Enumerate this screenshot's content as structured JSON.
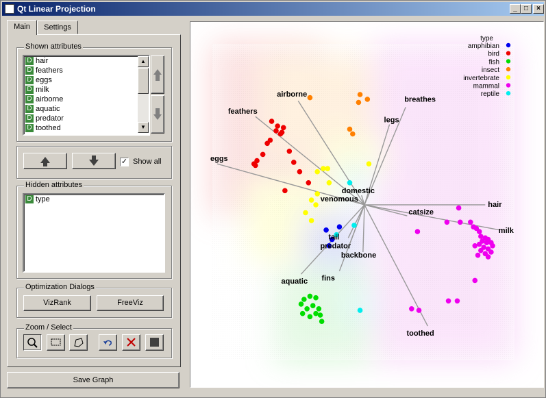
{
  "window": {
    "title": "Qt Linear Projection",
    "controls": [
      "_",
      "□",
      "×"
    ]
  },
  "tabs": [
    {
      "label": "Main",
      "active": true
    },
    {
      "label": "Settings",
      "active": false
    }
  ],
  "shown_attributes": {
    "label": "Shown attributes",
    "items": [
      "hair",
      "feathers",
      "eggs",
      "milk",
      "airborne",
      "aquatic",
      "predator",
      "toothed"
    ]
  },
  "show_all": {
    "label": "Show all",
    "checked": true
  },
  "hidden_attributes": {
    "label": "Hidden attributes",
    "items": [
      "type"
    ]
  },
  "optimization": {
    "label": "Optimization Dialogs",
    "vizrank": "VizRank",
    "freeviz": "FreeViz"
  },
  "zoom_select": {
    "label": "Zoom / Select"
  },
  "save_graph": "Save Graph",
  "attribute_badge": "D",
  "colors": {
    "amphibian": "#0000ee",
    "bird": "#ee0000",
    "fish": "#00dd00",
    "insect": "#ff8000",
    "invertebrate": "#ffff00",
    "mammal": "#ee00ee",
    "reptile": "#00eeee"
  },
  "chart_data": {
    "type": "scatter",
    "legend": {
      "title": "type",
      "placement": "top-right",
      "entries": [
        "amphibian",
        "bird",
        "fish",
        "insect",
        "invertebrate",
        "mammal",
        "reptile"
      ]
    },
    "anchors": [
      {
        "name": "airborne",
        "x": -0.45,
        "y": 0.66
      },
      {
        "name": "breathes",
        "x": 0.28,
        "y": 0.62
      },
      {
        "name": "legs",
        "x": 0.17,
        "y": 0.51
      },
      {
        "name": "feathers",
        "x": -0.74,
        "y": 0.56
      },
      {
        "name": "eggs",
        "x": -1.0,
        "y": 0.26
      },
      {
        "name": "domestic",
        "x": -0.02,
        "y": 0.06
      },
      {
        "name": "venomous",
        "x": -0.08,
        "y": 0.03
      },
      {
        "name": "hair",
        "x": 0.82,
        "y": 0.0
      },
      {
        "name": "catsize",
        "x": 0.29,
        "y": -0.07
      },
      {
        "name": "milk",
        "x": 0.92,
        "y": -0.16
      },
      {
        "name": "tail",
        "x": -0.11,
        "y": -0.21
      },
      {
        "name": "predator",
        "x": -0.1,
        "y": -0.25
      },
      {
        "name": "backbone",
        "x": -0.01,
        "y": -0.3
      },
      {
        "name": "aquatic",
        "x": -0.43,
        "y": -0.44
      },
      {
        "name": "fins",
        "x": -0.17,
        "y": -0.42
      },
      {
        "name": "toothed",
        "x": 0.43,
        "y": -0.77
      }
    ],
    "points": [
      {
        "c": "amphibian",
        "x": -0.26,
        "y": -0.16
      },
      {
        "c": "amphibian",
        "x": -0.17,
        "y": -0.14
      },
      {
        "c": "amphibian",
        "x": -0.22,
        "y": -0.22
      },
      {
        "c": "amphibian",
        "x": -0.24,
        "y": -0.26
      },
      {
        "c": "bird",
        "x": -0.63,
        "y": 0.53
      },
      {
        "c": "bird",
        "x": -0.59,
        "y": 0.5
      },
      {
        "c": "bird",
        "x": -0.6,
        "y": 0.47
      },
      {
        "c": "bird",
        "x": -0.56,
        "y": 0.46
      },
      {
        "c": "bird",
        "x": -0.55,
        "y": 0.49
      },
      {
        "c": "bird",
        "x": -0.57,
        "y": 0.45
      },
      {
        "c": "bird",
        "x": -0.64,
        "y": 0.41
      },
      {
        "c": "bird",
        "x": -0.66,
        "y": 0.39
      },
      {
        "c": "bird",
        "x": -0.69,
        "y": 0.32
      },
      {
        "c": "bird",
        "x": -0.73,
        "y": 0.28
      },
      {
        "c": "bird",
        "x": -0.75,
        "y": 0.26
      },
      {
        "c": "bird",
        "x": -0.74,
        "y": 0.25
      },
      {
        "c": "bird",
        "x": -0.51,
        "y": 0.34
      },
      {
        "c": "bird",
        "x": -0.48,
        "y": 0.27
      },
      {
        "c": "bird",
        "x": -0.44,
        "y": 0.21
      },
      {
        "c": "bird",
        "x": -0.38,
        "y": 0.14
      },
      {
        "c": "bird",
        "x": -0.54,
        "y": 0.09
      },
      {
        "c": "fish",
        "x": -0.41,
        "y": -0.6
      },
      {
        "c": "fish",
        "x": -0.37,
        "y": -0.58
      },
      {
        "c": "fish",
        "x": -0.33,
        "y": -0.59
      },
      {
        "c": "fish",
        "x": -0.35,
        "y": -0.64
      },
      {
        "c": "fish",
        "x": -0.31,
        "y": -0.66
      },
      {
        "c": "fish",
        "x": -0.43,
        "y": -0.63
      },
      {
        "c": "fish",
        "x": -0.39,
        "y": -0.66
      },
      {
        "c": "fish",
        "x": -0.42,
        "y": -0.69
      },
      {
        "c": "fish",
        "x": -0.37,
        "y": -0.71
      },
      {
        "c": "fish",
        "x": -0.33,
        "y": -0.69
      },
      {
        "c": "fish",
        "x": -0.3,
        "y": -0.7
      },
      {
        "c": "fish",
        "x": -0.29,
        "y": -0.74
      },
      {
        "c": "insect",
        "x": -0.37,
        "y": 0.68
      },
      {
        "c": "insect",
        "x": -0.03,
        "y": 0.7
      },
      {
        "c": "insect",
        "x": 0.02,
        "y": 0.67
      },
      {
        "c": "insect",
        "x": -0.04,
        "y": 0.65
      },
      {
        "c": "insect",
        "x": -0.1,
        "y": 0.48
      },
      {
        "c": "insect",
        "x": -0.08,
        "y": 0.45
      },
      {
        "c": "invertebrate",
        "x": -0.32,
        "y": 0.21
      },
      {
        "c": "invertebrate",
        "x": -0.28,
        "y": 0.23
      },
      {
        "c": "invertebrate",
        "x": -0.25,
        "y": 0.23
      },
      {
        "c": "invertebrate",
        "x": -0.32,
        "y": 0.07
      },
      {
        "c": "invertebrate",
        "x": -0.36,
        "y": 0.03
      },
      {
        "c": "invertebrate",
        "x": -0.33,
        "y": 0.0
      },
      {
        "c": "invertebrate",
        "x": -0.4,
        "y": -0.05
      },
      {
        "c": "invertebrate",
        "x": -0.36,
        "y": -0.1
      },
      {
        "c": "invertebrate",
        "x": -0.24,
        "y": 0.14
      },
      {
        "c": "invertebrate",
        "x": 0.03,
        "y": 0.26
      },
      {
        "c": "mammal",
        "x": 0.64,
        "y": -0.02
      },
      {
        "c": "mammal",
        "x": 0.56,
        "y": -0.11
      },
      {
        "c": "mammal",
        "x": 0.65,
        "y": -0.11
      },
      {
        "c": "mammal",
        "x": 0.72,
        "y": -0.11
      },
      {
        "c": "mammal",
        "x": 0.74,
        "y": -0.14
      },
      {
        "c": "mammal",
        "x": 0.76,
        "y": -0.15
      },
      {
        "c": "mammal",
        "x": 0.78,
        "y": -0.17
      },
      {
        "c": "mammal",
        "x": 0.79,
        "y": -0.2
      },
      {
        "c": "mammal",
        "x": 0.82,
        "y": -0.21
      },
      {
        "c": "mammal",
        "x": 0.84,
        "y": -0.22
      },
      {
        "c": "mammal",
        "x": 0.8,
        "y": -0.23
      },
      {
        "c": "mammal",
        "x": 0.83,
        "y": -0.24
      },
      {
        "c": "mammal",
        "x": 0.86,
        "y": -0.24
      },
      {
        "c": "mammal",
        "x": 0.78,
        "y": -0.25
      },
      {
        "c": "mammal",
        "x": 0.75,
        "y": -0.26
      },
      {
        "c": "mammal",
        "x": 0.87,
        "y": -0.26
      },
      {
        "c": "mammal",
        "x": 0.81,
        "y": -0.27
      },
      {
        "c": "mammal",
        "x": 0.84,
        "y": -0.28
      },
      {
        "c": "mammal",
        "x": 0.79,
        "y": -0.29
      },
      {
        "c": "mammal",
        "x": 0.86,
        "y": -0.3
      },
      {
        "c": "mammal",
        "x": 0.82,
        "y": -0.31
      },
      {
        "c": "mammal",
        "x": 0.77,
        "y": -0.32
      },
      {
        "c": "mammal",
        "x": 0.84,
        "y": -0.33
      },
      {
        "c": "mammal",
        "x": 0.36,
        "y": -0.17
      },
      {
        "c": "mammal",
        "x": 0.75,
        "y": -0.48
      },
      {
        "c": "mammal",
        "x": 0.57,
        "y": -0.61
      },
      {
        "c": "mammal",
        "x": 0.63,
        "y": -0.61
      },
      {
        "c": "mammal",
        "x": 0.32,
        "y": -0.66
      },
      {
        "c": "mammal",
        "x": 0.37,
        "y": -0.67
      },
      {
        "c": "reptile",
        "x": -0.1,
        "y": 0.14
      },
      {
        "c": "reptile",
        "x": -0.07,
        "y": -0.13
      },
      {
        "c": "reptile",
        "x": -0.19,
        "y": -0.19
      },
      {
        "c": "reptile",
        "x": -0.03,
        "y": -0.67
      }
    ]
  }
}
